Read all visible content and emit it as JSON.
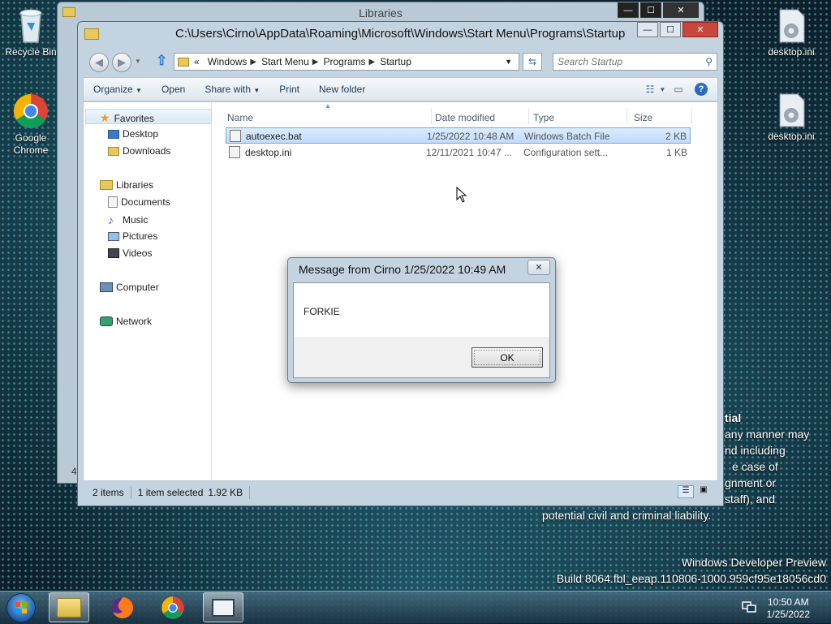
{
  "desktop": {
    "icons": [
      {
        "label": "Recycle Bin"
      },
      {
        "label": "Google Chrome"
      },
      {
        "label": "desktop.ini"
      },
      {
        "label": "desktop.ini"
      }
    ],
    "legal_lines": [
      "tial",
      "any manner may",
      "nd including",
      "e case of",
      "gnment or",
      "staff), and",
      "potential civil and criminal liability."
    ],
    "watermark_line1": "Windows Developer Preview",
    "watermark_line2": "Build 8064.fbl_eeap.110806-1000.959cf95e18056cd0"
  },
  "back_window": {
    "title": "Libraries",
    "left_edge_char": "4"
  },
  "explorer": {
    "title": "C:\\Users\\Cirno\\AppData\\Roaming\\Microsoft\\Windows\\Start Menu\\Programs\\Startup",
    "controls": {
      "minimize": "—",
      "maximize": "☐",
      "close": "✕"
    },
    "address": {
      "overflow": "«",
      "segments": [
        "Windows",
        "Start Menu",
        "Programs",
        "Startup"
      ]
    },
    "search_placeholder": "Search Startup",
    "toolbar": {
      "organize": "Organize",
      "open": "Open",
      "share_with": "Share with",
      "print": "Print",
      "new_folder": "New folder"
    },
    "nav": {
      "favorites": "Favorites",
      "desktop": "Desktop",
      "downloads": "Downloads",
      "libraries": "Libraries",
      "documents": "Documents",
      "music": "Music",
      "pictures": "Pictures",
      "videos": "Videos",
      "computer": "Computer",
      "network": "Network"
    },
    "columns": {
      "name": "Name",
      "date": "Date modified",
      "type": "Type",
      "size": "Size"
    },
    "files": [
      {
        "name": "autoexec.bat",
        "date": "1/25/2022 10:48 AM",
        "type": "Windows Batch File",
        "size": "2 KB",
        "selected": true
      },
      {
        "name": "desktop.ini",
        "date": "12/11/2021 10:47 ...",
        "type": "Configuration sett...",
        "size": "1 KB",
        "selected": false
      }
    ],
    "status": {
      "count": "2 items",
      "selection": "1 item selected",
      "size": "1.92 KB"
    }
  },
  "dialog": {
    "title": "Message from Cirno 1/25/2022 10:49 AM",
    "close": "✕",
    "message": "FORKIE",
    "ok": "OK"
  },
  "taskbar": {
    "time": "10:50 AM",
    "date": "1/25/2022"
  },
  "colors": {
    "selection": "#c1dcfc",
    "window_frame": "#c4d3e0",
    "close_red": "#c9463d"
  }
}
